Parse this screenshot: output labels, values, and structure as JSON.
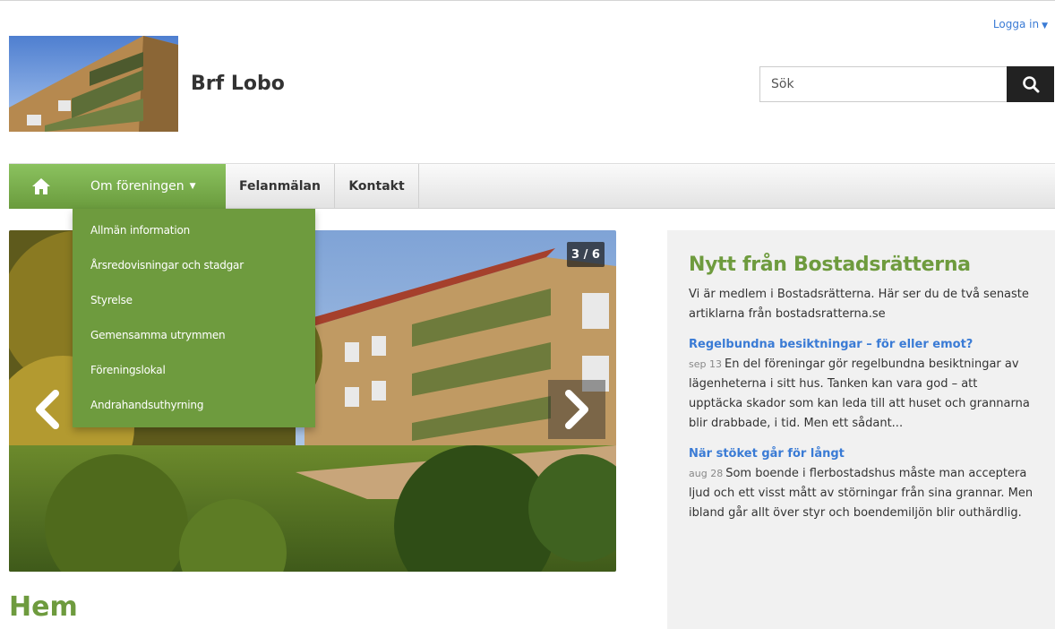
{
  "header": {
    "login_label": "Logga in",
    "site_title": "Brf Lobo"
  },
  "search": {
    "placeholder": "Sök"
  },
  "nav": {
    "home_icon": "home-icon",
    "active_label": "Om föreningen",
    "items": [
      "Felanmälan",
      "Kontakt"
    ]
  },
  "dropdown": {
    "items": [
      "Allmän information",
      "Årsredovisningar och stadgar",
      "Styrelse",
      "Gemensamma utrymmen",
      "Föreningslokal",
      "Andrahandsuthyrning"
    ]
  },
  "slider": {
    "counter": "3 / 6"
  },
  "page": {
    "heading": "Hem"
  },
  "news": {
    "title": "Nytt från Bostadsrätterna",
    "intro": "Vi är medlem i Bostadsrätterna. Här ser du de två senaste artiklarna från bostadsratterna.se",
    "articles": [
      {
        "title": "Regelbundna besiktningar – för eller emot?",
        "date": "sep 13",
        "excerpt": "En del föreningar gör regelbundna besiktningar av lägenheterna i sitt hus. Tanken kan vara god – att upptäcka skador som kan leda till att huset och grannarna blir drabbade, i tid. Men ett sådant..."
      },
      {
        "title": "När stöket går för långt",
        "date": "aug 28",
        "excerpt": "Som boende i flerbostadshus måste man acceptera ljud och ett visst mått av störningar från sina grannar. Men ibland går allt över styr och boendemiljön blir outhärdlig."
      }
    ]
  },
  "colors": {
    "brand_green": "#6e9b3e",
    "link_blue": "#3a7bd5"
  }
}
